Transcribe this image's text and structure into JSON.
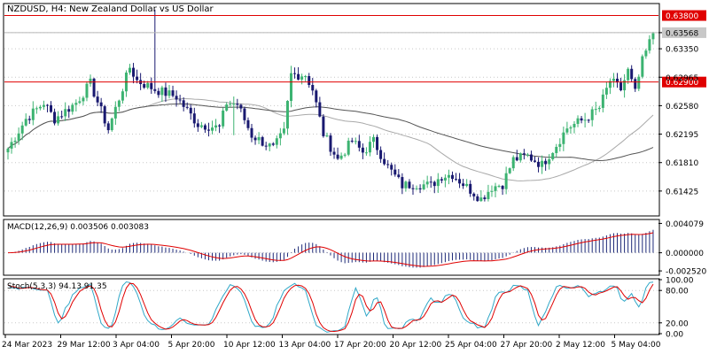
{
  "colors": {
    "bull": "#3cb371",
    "bear": "#191970",
    "ma_fast": "#a9a9a9",
    "ma_slow": "#555555",
    "macd_hist": "#1e2a78",
    "macd_signal": "#e00000",
    "stoch_main": "#30a8c8",
    "stoch_signal": "#e00000",
    "level": "#e00000",
    "grid": "#c8c8c8",
    "frame": "#000000"
  },
  "chart_data": [
    {
      "type": "candlestick",
      "title": "NZDUSD, H4:  New Zealand Dollar vs US Dollar",
      "ylim": [
        0.611,
        0.6395
      ],
      "yticks": [
        "0.63568",
        "0.63350",
        "0.62965",
        "0.62580",
        "0.62195",
        "0.61810",
        "0.61425"
      ],
      "yticks_values": [
        0.63568,
        0.6335,
        0.62965,
        0.6258,
        0.62195,
        0.6181,
        0.61425
      ],
      "xlabels": [
        "24 Mar 2023",
        "29 Mar 12:00",
        "3 Apr 04:00",
        "5 Apr 20:00",
        "10 Apr 12:00",
        "13 Apr 04:00",
        "17 Apr 20:00",
        "20 Apr 12:00",
        "25 Apr 04:00",
        "27 Apr 20:00",
        "2 May 12:00",
        "5 May 04:00"
      ],
      "price_labels": [
        {
          "label": "0.63800",
          "value": 0.638,
          "style": "line"
        },
        {
          "label": "0.63568",
          "value": 0.63568,
          "style": "current"
        },
        {
          "label": "0.62900",
          "value": 0.629,
          "style": "line"
        }
      ],
      "close_path": [
        [
          0,
          0.62
        ],
        [
          5,
          0.624
        ],
        [
          10,
          0.6262
        ],
        [
          13,
          0.624
        ],
        [
          19,
          0.6262
        ],
        [
          23,
          0.6288
        ],
        [
          28,
          0.6226
        ],
        [
          34,
          0.631
        ],
        [
          36,
          0.6292
        ],
        [
          41,
          0.628
        ],
        [
          47,
          0.627
        ],
        [
          53,
          0.6233
        ],
        [
          59,
          0.6228
        ],
        [
          61,
          0.6262
        ],
        [
          64,
          0.626
        ],
        [
          68,
          0.6218
        ],
        [
          74,
          0.62
        ],
        [
          77,
          0.6222
        ],
        [
          79,
          0.63
        ],
        [
          83,
          0.63
        ],
        [
          85,
          0.628
        ],
        [
          88,
          0.622
        ],
        [
          92,
          0.6185
        ],
        [
          96,
          0.621
        ],
        [
          99,
          0.6195
        ],
        [
          102,
          0.621
        ],
        [
          106,
          0.6175
        ],
        [
          110,
          0.615
        ],
        [
          114,
          0.6152
        ],
        [
          118,
          0.615
        ],
        [
          121,
          0.6163
        ],
        [
          124,
          0.6165
        ],
        [
          128,
          0.6148
        ],
        [
          132,
          0.6132
        ],
        [
          135,
          0.6148
        ],
        [
          138,
          0.6152
        ],
        [
          141,
          0.6185
        ],
        [
          145,
          0.619
        ],
        [
          149,
          0.6178
        ],
        [
          153,
          0.6205
        ],
        [
          156,
          0.6228
        ],
        [
          161,
          0.624
        ],
        [
          165,
          0.6255
        ],
        [
          168,
          0.6292
        ],
        [
          171,
          0.628
        ],
        [
          173,
          0.6305
        ],
        [
          175,
          0.6275
        ],
        [
          177,
          0.6318
        ],
        [
          180,
          0.6356
        ]
      ],
      "series": [
        {
          "name": "",
          "kind": "ma_fast"
        },
        {
          "name": "",
          "kind": "ma_slow"
        }
      ]
    },
    {
      "type": "bar",
      "title": "MACD(12,26,9) 0.003506 0.003083",
      "ylim": [
        -0.003,
        0.0045
      ],
      "yticks": [
        "0.004079",
        "0.000000",
        "-0.002520"
      ],
      "yticks_values": [
        0.004079,
        0.0,
        -0.00252
      ],
      "histogram": "macd_minus_signal",
      "signal": "ema9"
    },
    {
      "type": "line",
      "title": "Stoch(5,3,3) 94.13 91.35",
      "ylim": [
        0,
        100
      ],
      "yticks": [
        "100.00",
        "80.00",
        "20.00",
        "0.00"
      ],
      "yticks_values": [
        100,
        80,
        20,
        0
      ]
    }
  ]
}
